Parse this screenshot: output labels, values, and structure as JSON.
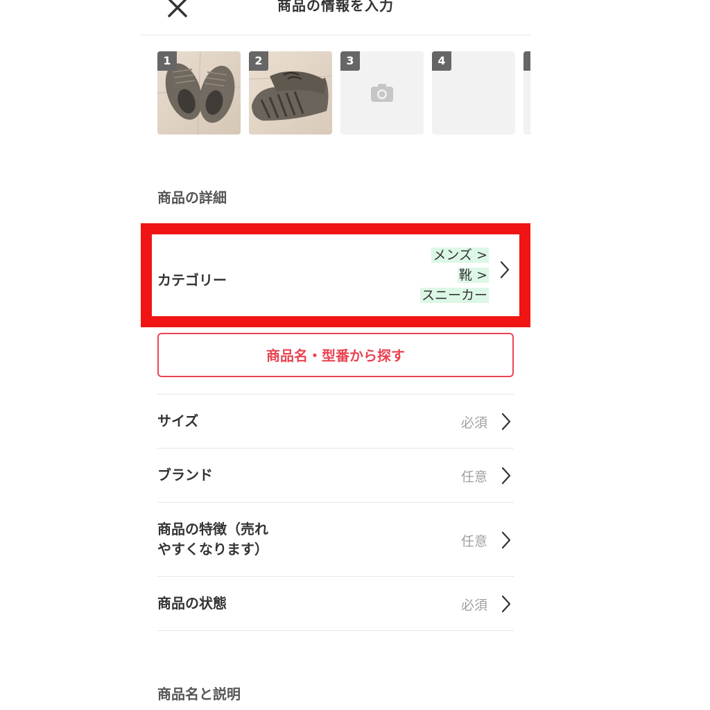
{
  "header": {
    "title": "商品の情報を入力",
    "close_icon": "close-icon"
  },
  "photos": [
    {
      "number": "1",
      "state": "filled",
      "description": "shoe-photo"
    },
    {
      "number": "2",
      "state": "filled",
      "description": "shoe-photo"
    },
    {
      "number": "3",
      "state": "empty",
      "icon": "camera-icon"
    },
    {
      "number": "4",
      "state": "empty"
    }
  ],
  "details": {
    "section_title": "商品の詳細",
    "category": {
      "label": "カテゴリー",
      "path": [
        "メンズ >",
        "靴 >",
        "スニーカー"
      ]
    },
    "search_button": "商品名・型番から探す",
    "rows": [
      {
        "label": "サイズ",
        "value": "必須"
      },
      {
        "label": "ブランド",
        "value": "任意"
      },
      {
        "label_line1": "商品の特徴（売れ",
        "label_line2": "やすくなります）",
        "value": "任意"
      },
      {
        "label": "商品の状態",
        "value": "必須"
      }
    ]
  },
  "name_section": {
    "title": "商品名と説明"
  },
  "colors": {
    "highlight_frame": "#f01414",
    "accent": "#ea4352",
    "category_highlight": "#ddf7e6",
    "placeholder_bg": "#f2f2f2",
    "badge_bg": "#666666"
  }
}
